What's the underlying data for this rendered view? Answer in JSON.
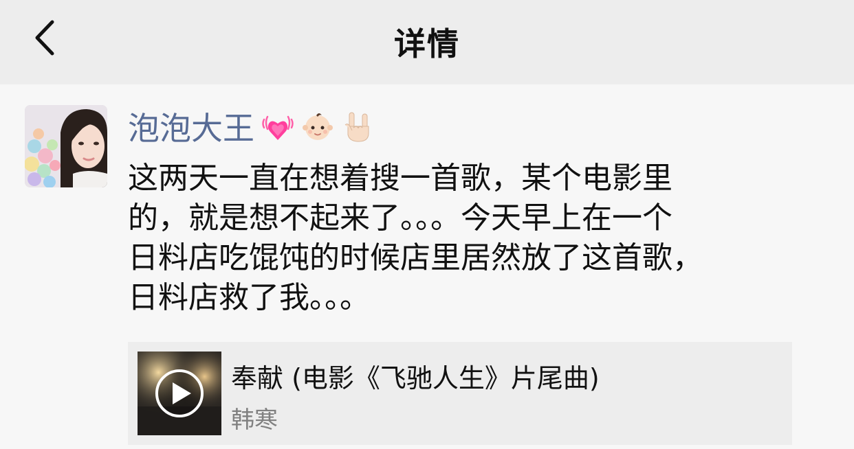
{
  "header": {
    "title": "详情",
    "back_icon": "chevron-left-icon"
  },
  "post": {
    "avatar_icon": "user-photo-avatar",
    "username": "泡泡大王",
    "username_emojis": [
      "growing-heart-emoji",
      "baby-emoji",
      "rock-on-hand-emoji"
    ],
    "text_lines": [
      "这两天一直在想着搜一首歌，某个电影里",
      "的，就是想不起来了。。。今天早上在一个",
      "日料店吃馄饨的时候店里居然放了这首歌，",
      "日料店救了我。。。"
    ]
  },
  "music": {
    "title": "奉献 (电影《飞驰人生》片尾曲)",
    "artist": "韩寒",
    "play_icon": "play-icon"
  },
  "colors": {
    "header_bg": "#ededed",
    "page_bg": "#f7f7f7",
    "username": "#576b95",
    "card_bg": "#ededed",
    "secondary_text": "#808080"
  }
}
